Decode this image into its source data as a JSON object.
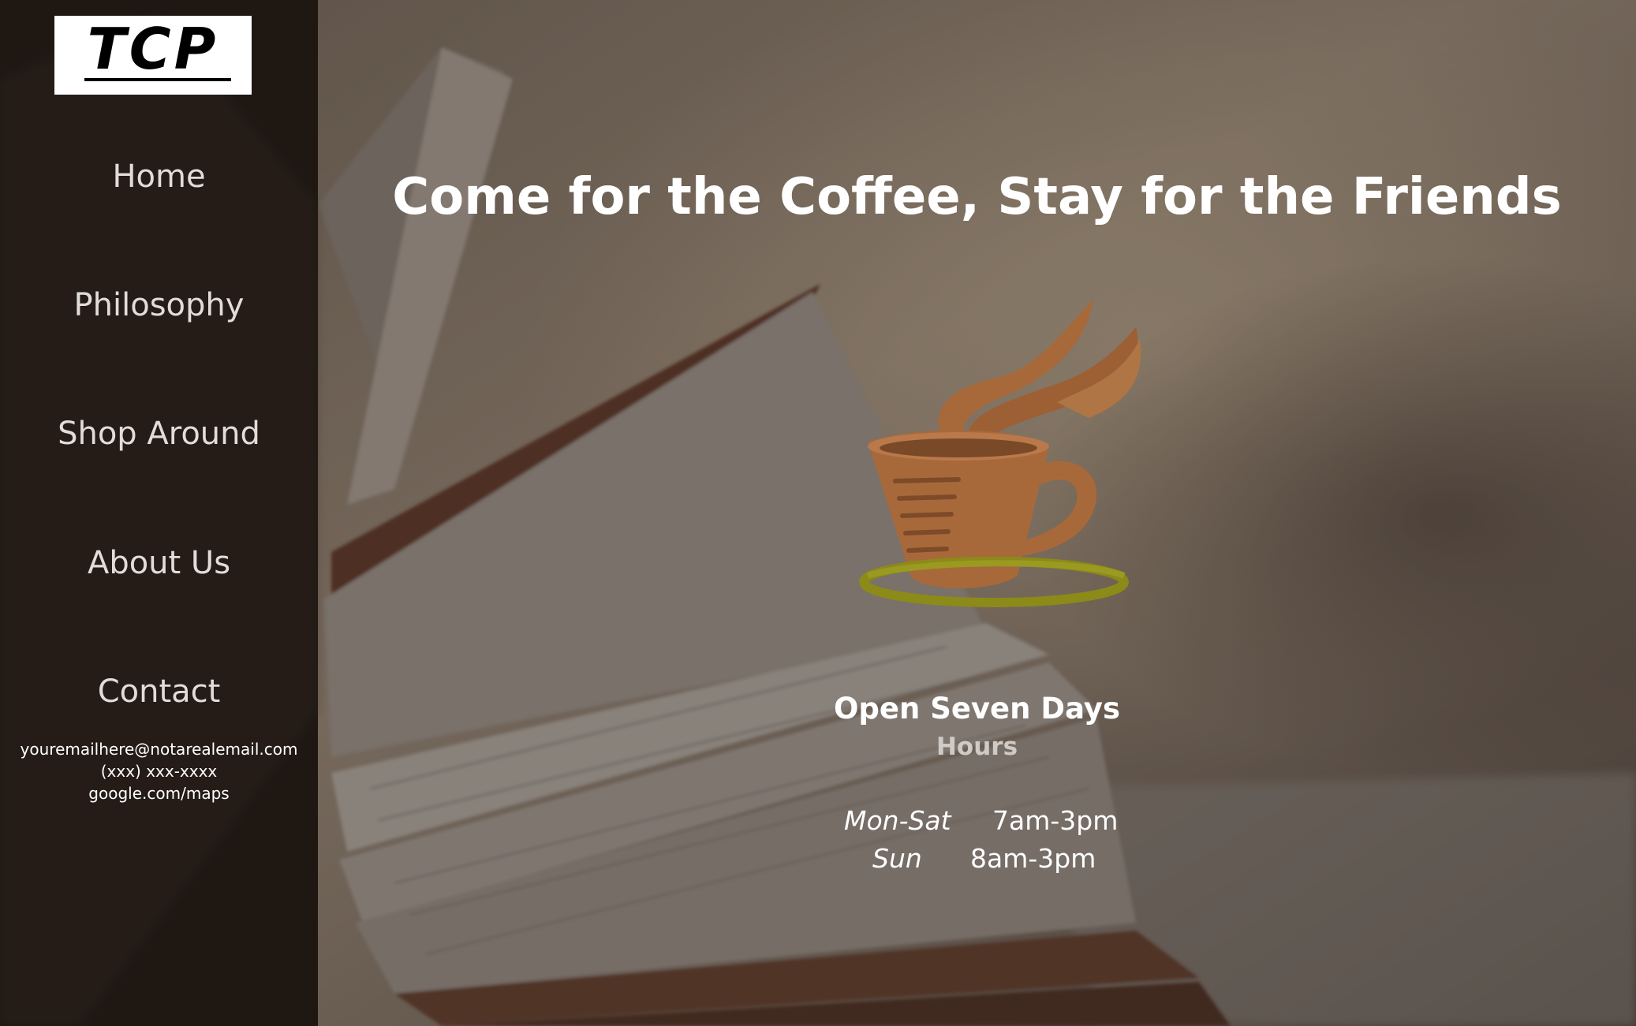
{
  "sidebar": {
    "logo_text": "TCP",
    "nav": [
      {
        "label": "Home"
      },
      {
        "label": "Philosophy"
      },
      {
        "label": "Shop Around"
      },
      {
        "label": "About Us"
      },
      {
        "label": "Contact"
      }
    ],
    "contact": {
      "email": "youremailhere@notarealemail.com",
      "phone": "(xxx) xxx-xxxx",
      "map": "google.com/maps"
    }
  },
  "main": {
    "headline": "Come for the Coffee, Stay for the Friends",
    "cup_icon": "coffee-cup-icon",
    "open_days": "Open Seven Days",
    "hours_title": "Hours",
    "hours": [
      {
        "day": "Mon-Sat",
        "time": "7am-3pm"
      },
      {
        "day": "Sun",
        "time": "8am-3pm"
      }
    ]
  },
  "colors": {
    "sidebar_bg": "#120e0c",
    "cup": "#a8693a",
    "saucer": "#8c8a18",
    "headline": "#ffffff"
  }
}
